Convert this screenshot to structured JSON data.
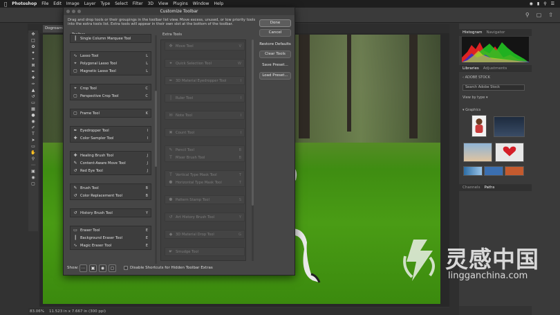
{
  "menubar": {
    "app": "Photoshop",
    "items": [
      "File",
      "Edit",
      "Image",
      "Layer",
      "Type",
      "Select",
      "Filter",
      "3D",
      "View",
      "Plugins",
      "Window",
      "Help"
    ]
  },
  "document": {
    "tab_label": "Dogroaming.png",
    "status_zoom": "83.06%",
    "status_info": "11.523 in x 7.667 in (300 ppi)"
  },
  "dialog": {
    "title": "Customize Toolbar",
    "instructions": "Drag and drop tools or their groupings in the toolbar list view. Move excess, unused, or low priority tools into the extra tools list. Extra tools will appear in their own slot at the bottom of the toolbar.",
    "toolbar_label": "Toolbar",
    "extra_label": "Extra Tools",
    "buttons": {
      "done": "Done",
      "cancel": "Cancel",
      "restore": "Restore Defaults",
      "clear": "Clear Tools",
      "save_preset": "Save Preset...",
      "load_preset": "Load Preset..."
    },
    "show_label": "Show:",
    "disable_shortcuts": "Disable Shortcuts for Hidden Toolbar Extras",
    "toolbar_groups": [
      {
        "rows": [
          {
            "name": "Single Column Marquee Tool",
            "key": ""
          }
        ]
      },
      {
        "rows": [
          {
            "name": "Lasso Tool",
            "key": "L"
          },
          {
            "name": "Polygonal Lasso Tool",
            "key": "L"
          },
          {
            "name": "Magnetic Lasso Tool",
            "key": "L"
          }
        ]
      },
      {
        "rows": [
          {
            "name": "Crop Tool",
            "key": "C"
          },
          {
            "name": "Perspective Crop Tool",
            "key": "C"
          }
        ]
      },
      {
        "rows": [
          {
            "name": "Frame Tool",
            "key": "K"
          }
        ]
      },
      {
        "rows": [
          {
            "name": "Eyedropper Tool",
            "key": "I"
          },
          {
            "name": "Color Sampler Tool",
            "key": "I"
          }
        ]
      },
      {
        "rows": [
          {
            "name": "Healing Brush Tool",
            "key": "J"
          },
          {
            "name": "Content-Aware Move Tool",
            "key": "J"
          },
          {
            "name": "Red Eye Tool",
            "key": "J"
          }
        ]
      },
      {
        "rows": [
          {
            "name": "Brush Tool",
            "key": "B"
          },
          {
            "name": "Color Replacement Tool",
            "key": "B"
          }
        ]
      },
      {
        "rows": [
          {
            "name": "History Brush Tool",
            "key": "Y"
          }
        ]
      },
      {
        "rows": [
          {
            "name": "Eraser Tool",
            "key": "E"
          },
          {
            "name": "Background Eraser Tool",
            "key": "E"
          },
          {
            "name": "Magic Eraser Tool",
            "key": "E"
          }
        ]
      }
    ],
    "extra_groups": [
      {
        "rows": [
          {
            "name": "Move Tool",
            "key": "V"
          }
        ]
      },
      {
        "rows": [
          {
            "name": "Quick Selection Tool",
            "key": "W"
          }
        ]
      },
      {
        "rows": [
          {
            "name": "3D Material Eyedropper Tool",
            "key": "I"
          }
        ]
      },
      {
        "rows": [
          {
            "name": "Ruler Tool",
            "key": "I"
          }
        ]
      },
      {
        "rows": [
          {
            "name": "Note Tool",
            "key": "I"
          }
        ]
      },
      {
        "rows": [
          {
            "name": "Count Tool",
            "key": "I"
          }
        ]
      },
      {
        "rows": [
          {
            "name": "Pencil Tool",
            "key": "B"
          },
          {
            "name": "Mixer Brush Tool",
            "key": "B"
          }
        ]
      },
      {
        "rows": [
          {
            "name": "Vertical Type Mask Tool",
            "key": "T"
          },
          {
            "name": "Horizontal Type Mask Tool",
            "key": "T"
          }
        ]
      },
      {
        "rows": [
          {
            "name": "Pattern Stamp Tool",
            "key": "S"
          }
        ]
      },
      {
        "rows": [
          {
            "name": "Art History Brush Tool",
            "key": "Y"
          }
        ]
      },
      {
        "rows": [
          {
            "name": "3D Material Drop Tool",
            "key": "G"
          }
        ]
      },
      {
        "rows": [
          {
            "name": "Smudge Tool",
            "key": ""
          }
        ]
      }
    ]
  },
  "panels": {
    "histogram_tabs": [
      "Histogram",
      "Navigator"
    ],
    "library_tabs": [
      "Libraries",
      "Adjustments"
    ],
    "library_name": "ADOBE STOCK",
    "search_placeholder": "Search Adobe Stock",
    "view_by": "View by type",
    "graphics_label": "Graphics",
    "channel_tabs": [
      "Channels",
      "Paths"
    ]
  },
  "watermark": {
    "cn": "灵感中国",
    "en": "lingganchina.com"
  }
}
